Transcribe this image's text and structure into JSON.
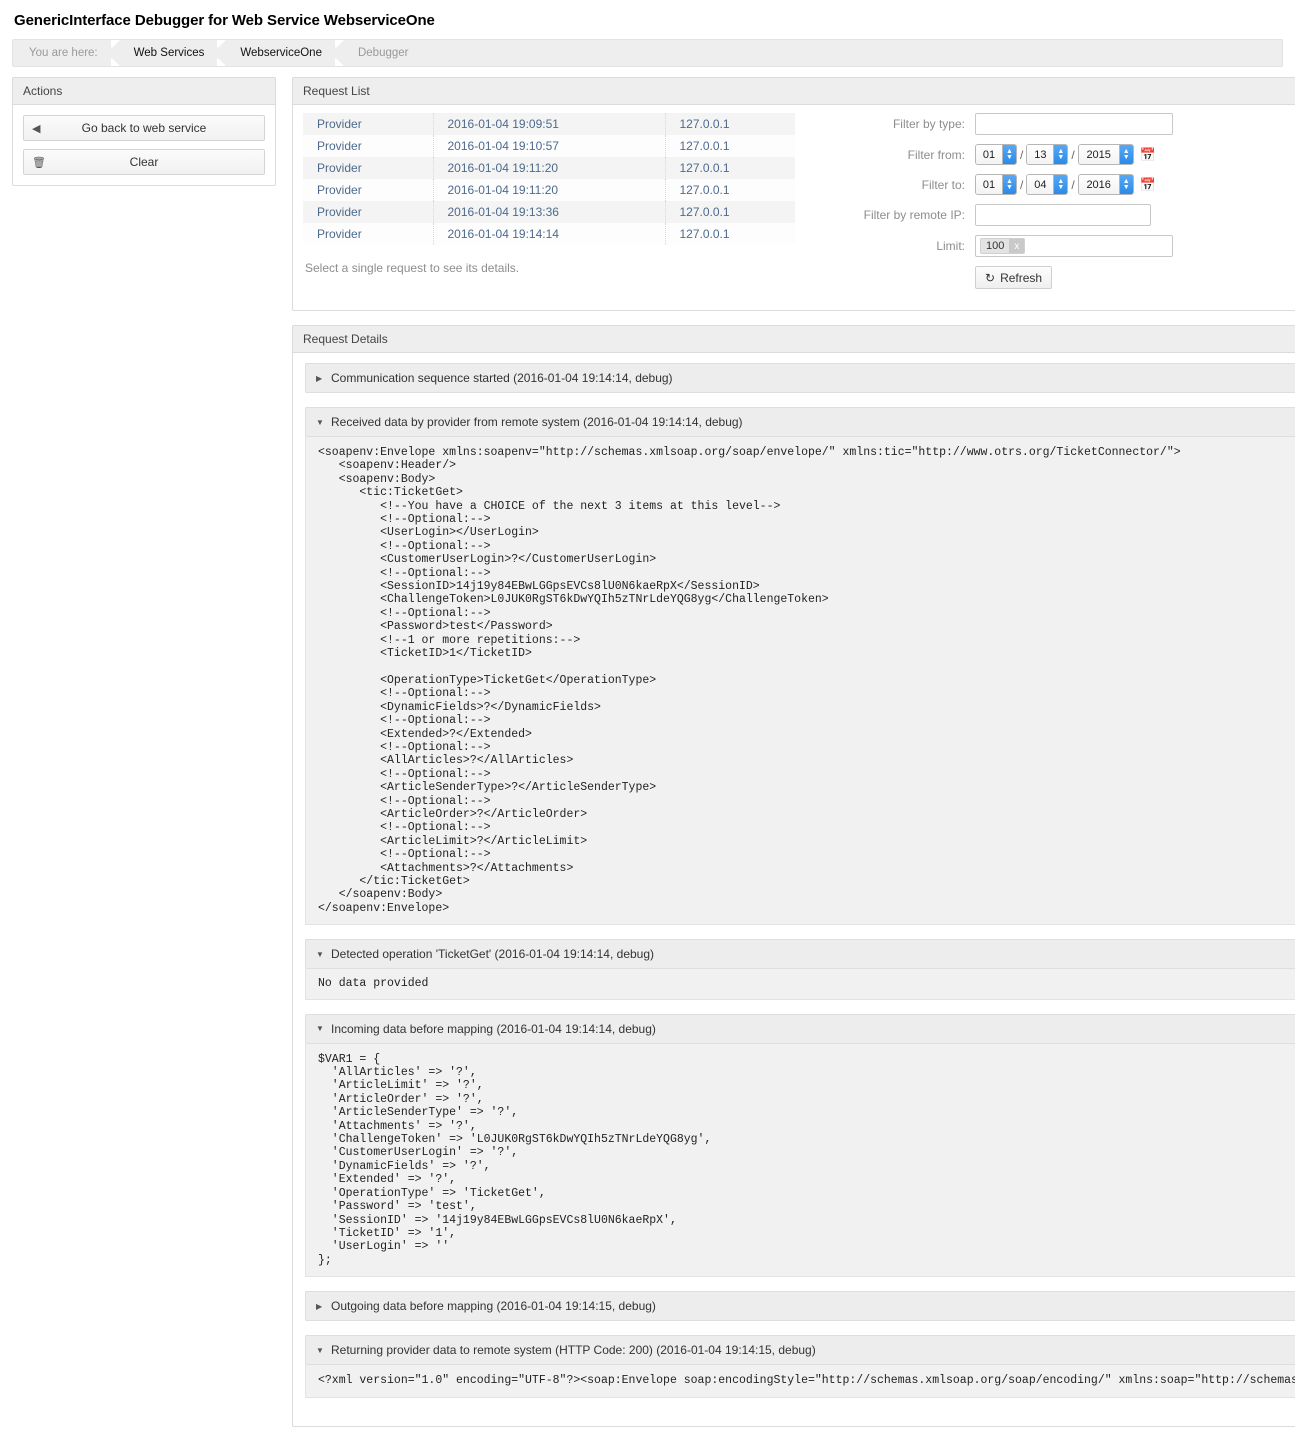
{
  "page_title": "GenericInterface Debugger for Web Service WebserviceOne",
  "breadcrumb": {
    "prefix": "You are here:",
    "items": [
      {
        "label": "Web Services",
        "current": false
      },
      {
        "label": "WebserviceOne",
        "current": false
      },
      {
        "label": "Debugger",
        "current": true
      }
    ]
  },
  "actions": {
    "title": "Actions",
    "go_back_label": "Go back to web service",
    "go_back_icon": "caret-left-icon",
    "clear_label": "Clear",
    "clear_icon": "trash-icon"
  },
  "request_list": {
    "title": "Request List",
    "rows": [
      {
        "type": "Provider",
        "time": "2016-01-04 19:09:51",
        "ip": "127.0.0.1"
      },
      {
        "type": "Provider",
        "time": "2016-01-04 19:10:57",
        "ip": "127.0.0.1"
      },
      {
        "type": "Provider",
        "time": "2016-01-04 19:11:20",
        "ip": "127.0.0.1"
      },
      {
        "type": "Provider",
        "time": "2016-01-04 19:11:20",
        "ip": "127.0.0.1"
      },
      {
        "type": "Provider",
        "time": "2016-01-04 19:13:36",
        "ip": "127.0.0.1"
      },
      {
        "type": "Provider",
        "time": "2016-01-04 19:14:14",
        "ip": "127.0.0.1"
      }
    ],
    "hint": "Select a single request to see its details."
  },
  "filters": {
    "type_label": "Filter by type:",
    "type_value": "",
    "from_label": "Filter from:",
    "from_month": "01",
    "from_day": "13",
    "from_year": "2015",
    "to_label": "Filter to:",
    "to_month": "01",
    "to_day": "04",
    "to_year": "2016",
    "remote_ip_label": "Filter by remote IP:",
    "remote_ip_value": "",
    "limit_label": "Limit:",
    "limit_token": "100",
    "limit_token_remove": "x",
    "refresh_label": "Refresh",
    "refresh_icon": "refresh-icon",
    "calendar_icon": "calendar-icon"
  },
  "request_details": {
    "title": "Request Details",
    "sections": [
      {
        "label": "Communication sequence started (2016-01-04 19:14:14, debug)",
        "expanded": false,
        "content": ""
      },
      {
        "label": "Received data by provider from remote system (2016-01-04 19:14:14, debug)",
        "expanded": true,
        "content": "<soapenv:Envelope xmlns:soapenv=\"http://schemas.xmlsoap.org/soap/envelope/\" xmlns:tic=\"http://www.otrs.org/TicketConnector/\">\n   <soapenv:Header/>\n   <soapenv:Body>\n      <tic:TicketGet>\n         <!--You have a CHOICE of the next 3 items at this level-->\n         <!--Optional:-->\n         <UserLogin></UserLogin>\n         <!--Optional:-->\n         <CustomerUserLogin>?</CustomerUserLogin>\n         <!--Optional:-->\n         <SessionID>14j19y84EBwLGGpsEVCs8lU0N6kaeRpX</SessionID>\n         <ChallengeToken>L0JUK0RgST6kDwYQIh5zTNrLdeYQG8yg</ChallengeToken>\n         <!--Optional:-->\n         <Password>test</Password>\n         <!--1 or more repetitions:-->\n         <TicketID>1</TicketID>\n\n         <OperationType>TicketGet</OperationType>\n         <!--Optional:-->\n         <DynamicFields>?</DynamicFields>\n         <!--Optional:-->\n         <Extended>?</Extended>\n         <!--Optional:-->\n         <AllArticles>?</AllArticles>\n         <!--Optional:-->\n         <ArticleSenderType>?</ArticleSenderType>\n         <!--Optional:-->\n         <ArticleOrder>?</ArticleOrder>\n         <!--Optional:-->\n         <ArticleLimit>?</ArticleLimit>\n         <!--Optional:-->\n         <Attachments>?</Attachments>\n      </tic:TicketGet>\n   </soapenv:Body>\n</soapenv:Envelope>"
      },
      {
        "label": "Detected operation 'TicketGet' (2016-01-04 19:14:14, debug)",
        "expanded": true,
        "content": "No data provided"
      },
      {
        "label": "Incoming data before mapping (2016-01-04 19:14:14, debug)",
        "expanded": true,
        "content": "$VAR1 = {\n  'AllArticles' => '?',\n  'ArticleLimit' => '?',\n  'ArticleOrder' => '?',\n  'ArticleSenderType' => '?',\n  'Attachments' => '?',\n  'ChallengeToken' => 'L0JUK0RgST6kDwYQIh5zTNrLdeYQG8yg',\n  'CustomerUserLogin' => '?',\n  'DynamicFields' => '?',\n  'Extended' => '?',\n  'OperationType' => 'TicketGet',\n  'Password' => 'test',\n  'SessionID' => '14j19y84EBwLGGpsEVCs8lU0N6kaeRpX',\n  'TicketID' => '1',\n  'UserLogin' => ''\n};"
      },
      {
        "label": "Outgoing data before mapping (2016-01-04 19:14:15, debug)",
        "expanded": false,
        "content": ""
      },
      {
        "label": "Returning provider data to remote system (HTTP Code: 200) (2016-01-04 19:14:15, debug)",
        "expanded": true,
        "content": "<?xml version=\"1.0\" encoding=\"UTF-8\"?><soap:Envelope soap:encodingStyle=\"http://schemas.xmlsoap.org/soap/encoding/\" xmlns:soap=\"http://schemas.xmlsoap.org/soap/envelope/\">"
      }
    ],
    "arrow_expanded": "▼",
    "arrow_collapsed": "▶"
  }
}
